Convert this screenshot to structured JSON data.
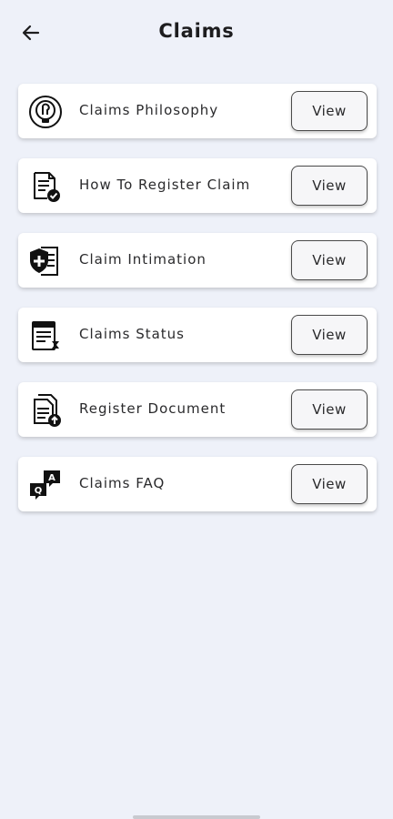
{
  "header": {
    "title": "Claims",
    "back_icon": "arrow-left-icon"
  },
  "items": [
    {
      "label": "Claims Philosophy",
      "icon": "philosophy-icon",
      "button": "View"
    },
    {
      "label": "How To Register Claim",
      "icon": "document-check-icon",
      "button": "View"
    },
    {
      "label": "Claim Intimation",
      "icon": "shield-plus-icon",
      "button": "View"
    },
    {
      "label": "Claims Status",
      "icon": "status-document-icon",
      "button": "View"
    },
    {
      "label": "Register Document",
      "icon": "document-upload-icon",
      "button": "View"
    },
    {
      "label": "Claims FAQ",
      "icon": "qa-bubbles-icon",
      "button": "View"
    }
  ],
  "colors": {
    "background": "#eef1f9",
    "card": "#ffffff",
    "text": "#1d1d1f"
  }
}
